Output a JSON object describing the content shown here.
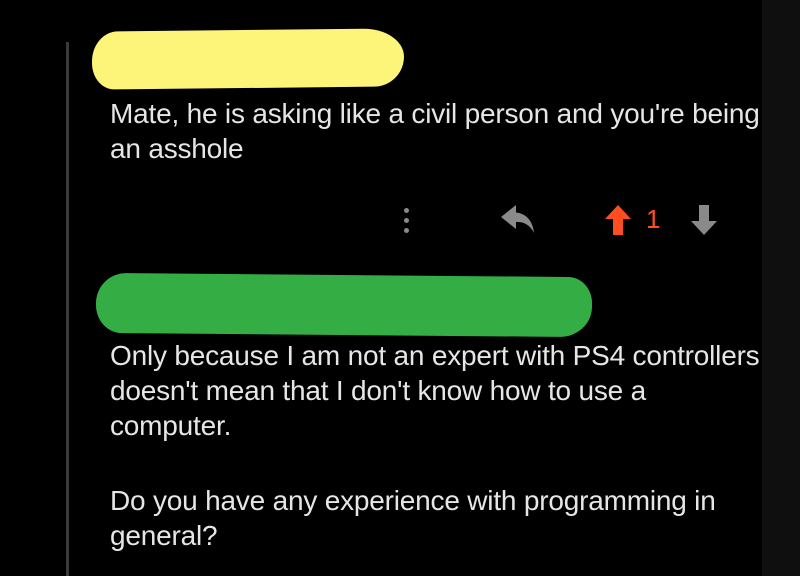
{
  "colors": {
    "background": "#000000",
    "text": "#e6e6e6",
    "upvote_active": "#ff4d22",
    "icon_gray": "#8a8a8a",
    "redaction_yellow": "#fdf57a",
    "redaction_green": "#34ad45"
  },
  "parent_comment": {
    "text": "Mate, he is asking like a civil person and you're being an asshole",
    "actions": {
      "more_icon": "kebab-vertical-icon",
      "reply_icon": "reply-arrow-icon",
      "upvote_icon": "upvote-arrow-icon",
      "vote_count": "1",
      "downvote_icon": "downvote-arrow-icon"
    }
  },
  "reply_comment": {
    "paragraphs": [
      "Only because I am not an expert with PS4 controllers doesn't mean that I don't know how to use a computer.",
      "Do you have any experience with programming in general?"
    ]
  }
}
